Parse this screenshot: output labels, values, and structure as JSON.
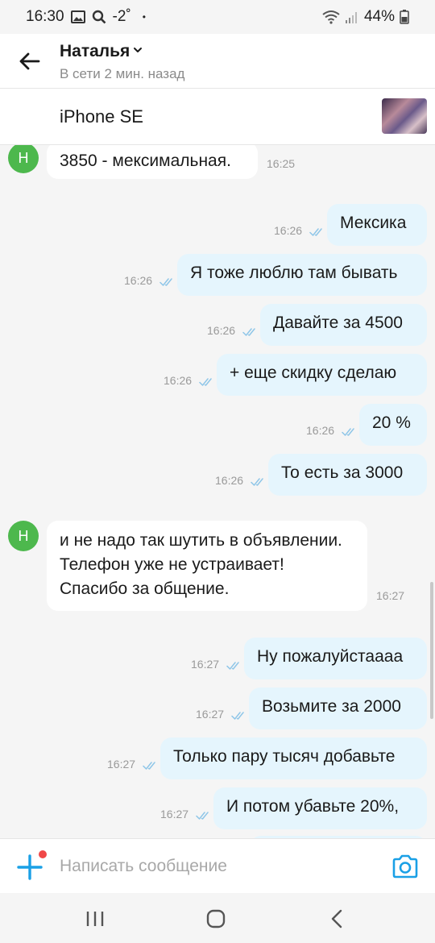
{
  "status_bar": {
    "time": "16:30",
    "temperature": "-2˚",
    "dot": "•",
    "battery": "44%",
    "icons": [
      "image-icon",
      "search-icon",
      "wifi-icon",
      "signal-icon",
      "battery-icon"
    ]
  },
  "header": {
    "name": "Наталья",
    "status": "В сети 2 мин. назад"
  },
  "item": {
    "title": "iPhone SE"
  },
  "chat": {
    "avatar_letter": "Н",
    "messages": [
      {
        "dir": "in",
        "text": "3850 - мексимальная.",
        "time": "16:25"
      },
      {
        "dir": "out",
        "text": "Мексика",
        "time": "16:26"
      },
      {
        "dir": "out",
        "text": "Я тоже люблю там бывать",
        "time": "16:26"
      },
      {
        "dir": "out",
        "text": "Давайте за 4500",
        "time": "16:26"
      },
      {
        "dir": "out",
        "text": "+ еще скидку сделаю",
        "time": "16:26"
      },
      {
        "dir": "out",
        "text": "20 %",
        "time": "16:26"
      },
      {
        "dir": "out",
        "text": "То есть за 3000",
        "time": "16:26"
      },
      {
        "dir": "in",
        "text": "и не надо так шутить в объявлении. Телефон уже не устраивает! Спасибо за общение.",
        "time": "16:27"
      },
      {
        "dir": "out",
        "text": "Ну пожалуйстаааа",
        "time": "16:27"
      },
      {
        "dir": "out",
        "text": "Возьмите за 2000",
        "time": "16:27"
      },
      {
        "dir": "out",
        "text": "Только пару тысяч добавьте",
        "time": "16:27"
      },
      {
        "dir": "out",
        "text": "И потом убавьте 20%,",
        "time": "16:27"
      }
    ]
  },
  "composer": {
    "placeholder": "Написать сообщение"
  },
  "colors": {
    "accent": "#1aa0e6",
    "outgoing_bubble": "#e5f5fd",
    "incoming_bubble": "#ffffff",
    "avatar": "#4db84d",
    "badge": "#f04848"
  }
}
